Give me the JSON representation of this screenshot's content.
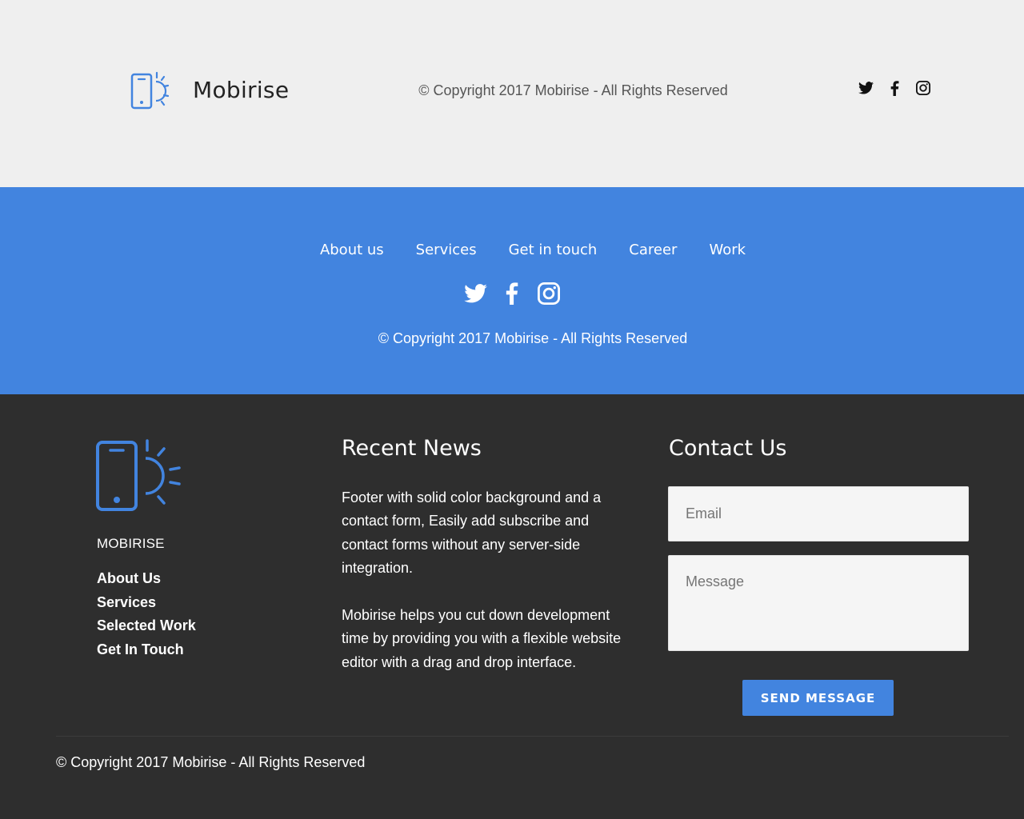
{
  "footer_light": {
    "brand": "Mobirise",
    "copyright": "© Copyright 2017 Mobirise - All Rights Reserved",
    "social": [
      "twitter-icon",
      "facebook-icon",
      "instagram-icon"
    ]
  },
  "footer_blue": {
    "nav": [
      "About us",
      "Services",
      "Get in touch",
      "Career",
      "Work"
    ],
    "social": [
      "twitter-icon",
      "facebook-icon",
      "instagram-icon"
    ],
    "copyright": "© Copyright 2017 Mobirise - All Rights Reserved"
  },
  "footer_dark": {
    "brand": "MOBIRISE",
    "links": [
      "About Us",
      "Services",
      "Selected Work",
      "Get In Touch"
    ],
    "news_title": "Recent News",
    "news_p1": "Footer with solid color background and a contact form, Easily add subscribe and contact forms without any server-side integration.",
    "news_p2": "Mobirise helps you cut down development time by providing you with a flexible website editor with a drag and drop interface.",
    "contact_title": "Contact Us",
    "email_placeholder": "Email",
    "message_placeholder": "Message",
    "send_label": "SEND MESSAGE",
    "copyright": "© Copyright 2017 Mobirise - All Rights Reserved"
  },
  "colors": {
    "brand_blue": "#4284df",
    "light_bg": "#efefef",
    "dark_bg": "#2e2e2e"
  }
}
